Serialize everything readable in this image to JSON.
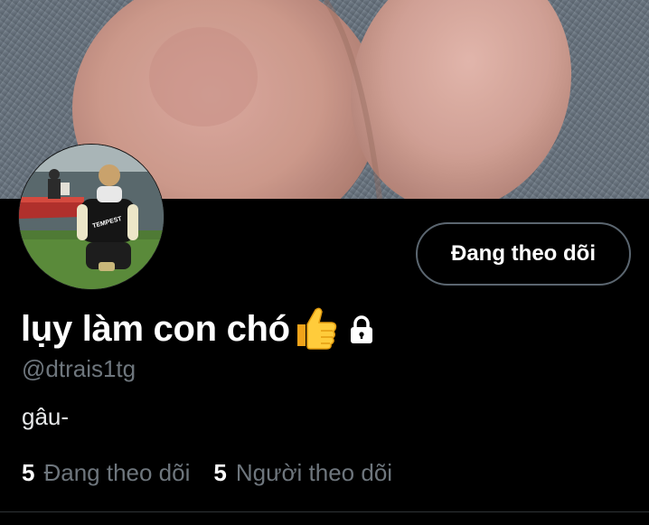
{
  "profile": {
    "display_name": "lụy làm con chó",
    "handle": "@dtrais1tg",
    "bio": "gâu-",
    "follow_button_label": "Đang theo dõi",
    "following_count": "5",
    "following_label": "Đang theo dõi",
    "followers_count": "5",
    "followers_label": "Người theo dõi"
  },
  "icons": {
    "name_emoji": "thumbs-up-icon",
    "protected": "lock-icon"
  },
  "colors": {
    "background": "#000000",
    "primary_text": "#ffffff",
    "secondary_text": "#6e767d",
    "button_border": "#5b6670",
    "divider": "#2f3336"
  }
}
